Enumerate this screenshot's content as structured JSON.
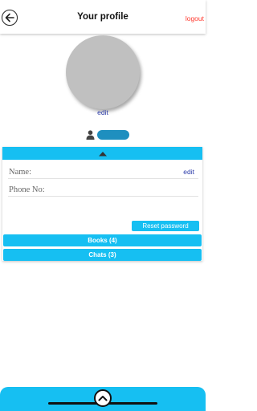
{
  "header": {
    "title": "Your profile",
    "logout_label": "logout",
    "back_icon": "back-arrow-icon"
  },
  "profile": {
    "avatar_edit_label": "edit",
    "user_icon": "user-icon"
  },
  "details": {
    "collapse_icon": "caret-up-icon",
    "name_label": "Name:",
    "phone_label": "Phone No:",
    "edit_label": "edit",
    "reset_password_label": "Reset password"
  },
  "sections": {
    "books_label": "Books (4)",
    "chats_label": "Chats (3)"
  },
  "bottom": {
    "up_icon": "chevron-up-icon"
  },
  "colors": {
    "accent": "#16bff2",
    "logout": "#ff3b30",
    "link": "#2a3aa8",
    "avatar_placeholder": "#c0c0c0",
    "username_pill": "#1e8fbf"
  }
}
